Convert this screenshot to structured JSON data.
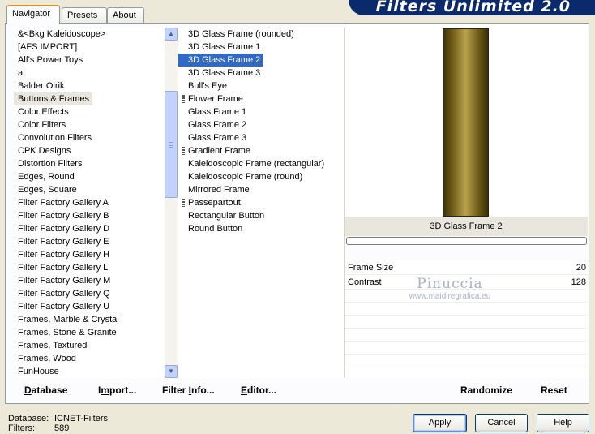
{
  "tabs": [
    "Navigator",
    "Presets",
    "About"
  ],
  "banner": "Filters Unlimited 2.0",
  "categories": [
    "&<Bkg Kaleidoscope>",
    "[AFS IMPORT]",
    "Alf's Power Toys",
    "a",
    "Balder Olrik",
    "Buttons & Frames",
    "Color Effects",
    "Color Filters",
    "Convolution Filters",
    "CPK Designs",
    "Distortion Filters",
    "Edges, Round",
    "Edges, Square",
    "Filter Factory Gallery A",
    "Filter Factory Gallery B",
    "Filter Factory Gallery D",
    "Filter Factory Gallery E",
    "Filter Factory Gallery H",
    "Filter Factory Gallery L",
    "Filter Factory Gallery M",
    "Filter Factory Gallery Q",
    "Filter Factory Gallery U",
    "Frames, Marble & Crystal",
    "Frames, Stone & Granite",
    "Frames, Textured",
    "Frames, Wood",
    "FunHouse"
  ],
  "filters": [
    "3D Glass Frame (rounded)",
    "3D Glass Frame 1",
    "3D Glass Frame 2",
    "3D Glass Frame 3",
    "Bull's Eye",
    "Flower Frame",
    "Glass Frame 1",
    "Glass Frame 2",
    "Glass Frame 3",
    "Gradient Frame",
    "Kaleidoscopic Frame (rectangular)",
    "Kaleidoscopic Frame (round)",
    "Mirrored Frame",
    "Passepartout",
    "Rectangular Button",
    "Round Button"
  ],
  "selected_filter_title": "3D Glass Frame 2",
  "params": [
    {
      "name": "Frame Size",
      "value": "20"
    },
    {
      "name": "Contrast",
      "value": "128"
    }
  ],
  "watermark": {
    "name": "Pinuccia",
    "url": "www.maidiregrafica.eu"
  },
  "actions": {
    "database_u": "D",
    "database_rest": "atabase",
    "import_pre": "I",
    "import_u": "m",
    "import_rest": "port...",
    "filterinfo_pre": "Filter ",
    "filterinfo_u": "I",
    "filterinfo_rest": "nfo...",
    "editor_u": "E",
    "editor_rest": "ditor...",
    "randomize": "Randomize",
    "reset": "Reset"
  },
  "status": {
    "database_label": "Database:",
    "database_value": "ICNET-Filters",
    "filters_label": "Filters:",
    "filters_value": "589"
  },
  "buttons": {
    "apply": "Apply",
    "cancel": "Cancel",
    "help": "Help"
  }
}
